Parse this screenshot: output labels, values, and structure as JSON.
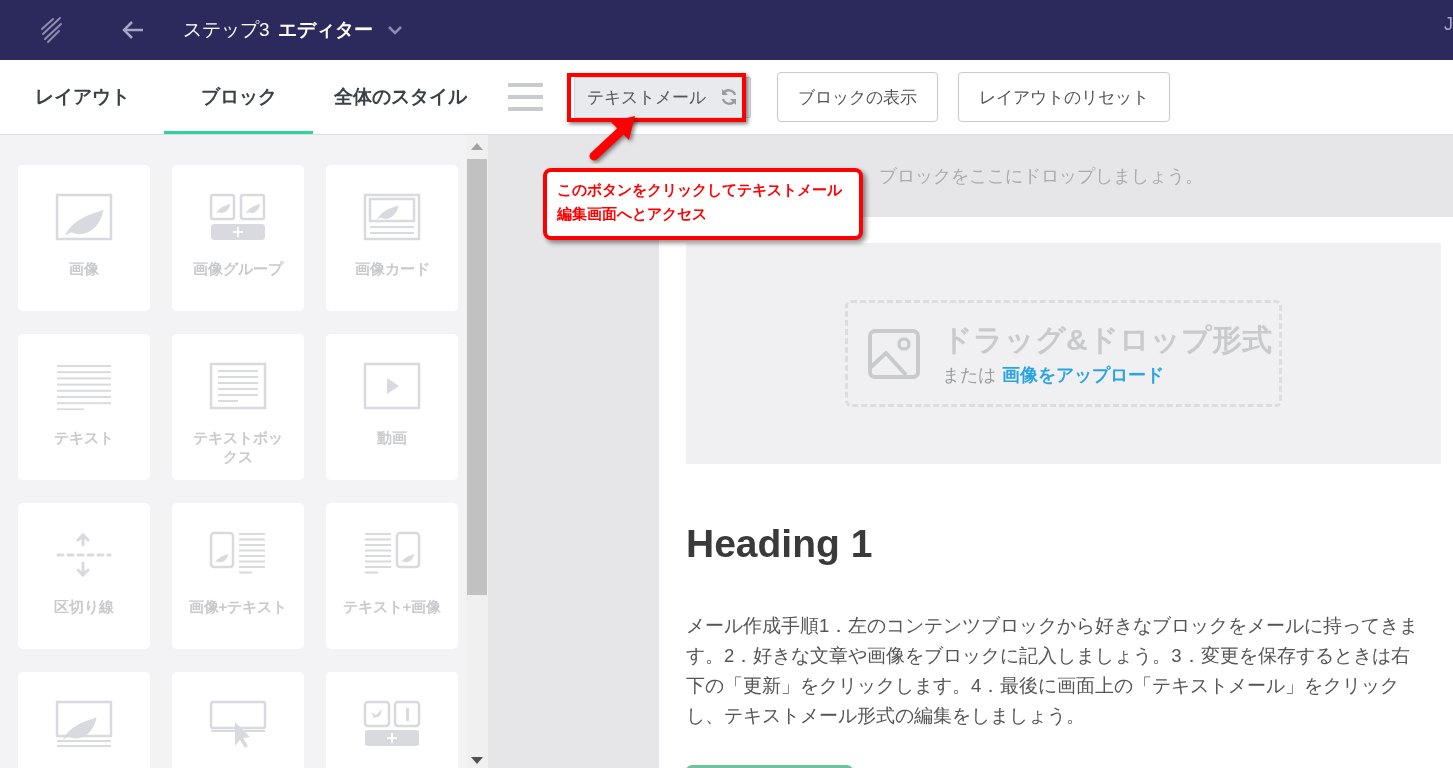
{
  "topbar": {
    "step": "ステップ3",
    "title": "エディター",
    "user_initial": "J"
  },
  "tabs": [
    {
      "label": "レイアウト",
      "selected": false
    },
    {
      "label": "ブロック",
      "selected": true
    },
    {
      "label": "全体のスタイル",
      "selected": false
    }
  ],
  "toolbar": {
    "buttons": [
      {
        "label": "テキストメール",
        "kind": "toggle"
      },
      {
        "label": "ブロックの表示",
        "kind": "outline"
      },
      {
        "label": "レイアウトのリセット",
        "kind": "outline"
      }
    ]
  },
  "blocks": [
    {
      "kind": "image",
      "label": "画像"
    },
    {
      "kind": "image-group",
      "label": "画像グループ"
    },
    {
      "kind": "image-card",
      "label": "画像カード"
    },
    {
      "kind": "text",
      "label": "テキスト"
    },
    {
      "kind": "textbox",
      "label": "テキストボックス"
    },
    {
      "kind": "video",
      "label": "動画"
    },
    {
      "kind": "divider",
      "label": "区切り線"
    },
    {
      "kind": "image-text",
      "label": "画像+テキスト"
    },
    {
      "kind": "text-image",
      "label": "テキスト+画像"
    },
    {
      "kind": "image-caption"
    },
    {
      "kind": "button"
    },
    {
      "kind": "social"
    }
  ],
  "canvas": {
    "drop_hint": "ブロックをここにドロップしましょう。",
    "upload": {
      "title": "ドラッグ&ドロップ形式",
      "prefix": "または",
      "link": "画像をアップロード"
    },
    "heading": "Heading 1",
    "paragraph": "メール作成手順1．左のコンテンツブロックから好きなブロックをメールに持ってきます。2．好きな文章や画像をブロックに記入しましょう。3．変更を保存するときは右下の「更新」をクリックします。4．最後に画面上の「テキストメール」をクリックし、テキストメール形式の編集をしましょう。"
  },
  "annotation": {
    "text": "このボタンをクリックしてテキストメール編集画面へとアクセス"
  }
}
